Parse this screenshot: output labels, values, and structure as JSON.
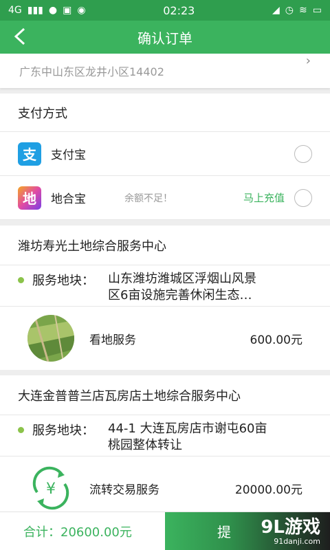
{
  "status": {
    "network": "4G",
    "time": "02:23"
  },
  "header": {
    "title": "确认订单"
  },
  "address": {
    "text": "广东中山东区龙井小区14402"
  },
  "payment": {
    "title": "支付方式",
    "options": [
      {
        "label": "支付宝",
        "icon": "alipay-icon",
        "color": "#1f9fe3"
      },
      {
        "label": "地合宝",
        "icon": "dihebao-icon",
        "hint": "余额不足！",
        "action": "马上充值",
        "color": "#e04aa5"
      }
    ]
  },
  "orders": [
    {
      "shop": "潍坊寿光土地综合服务中心",
      "plot_label": "服务地块：",
      "plot_line1": "山东潍坊潍城区浮烟山风景",
      "plot_line2": "区6亩设施完善休闲生态…",
      "service_name": "看地服务",
      "service_price": "600.00元"
    },
    {
      "shop": "大连金普普兰店瓦房店土地综合服务中心",
      "plot_label": "服务地块：",
      "plot_line1": "44-1 大连瓦房店市谢屯60亩",
      "plot_line2": "桃园整体转让",
      "service_name": "流转交易服务",
      "service_price": "20000.00元"
    }
  ],
  "footer": {
    "total": "合计：20600.00元",
    "submit": "提",
    "watermark": "9L游戏",
    "watermark_url": "91danji.com"
  },
  "colors": {
    "primary": "#3bb35e",
    "accent_dot": "#8bc34a"
  }
}
